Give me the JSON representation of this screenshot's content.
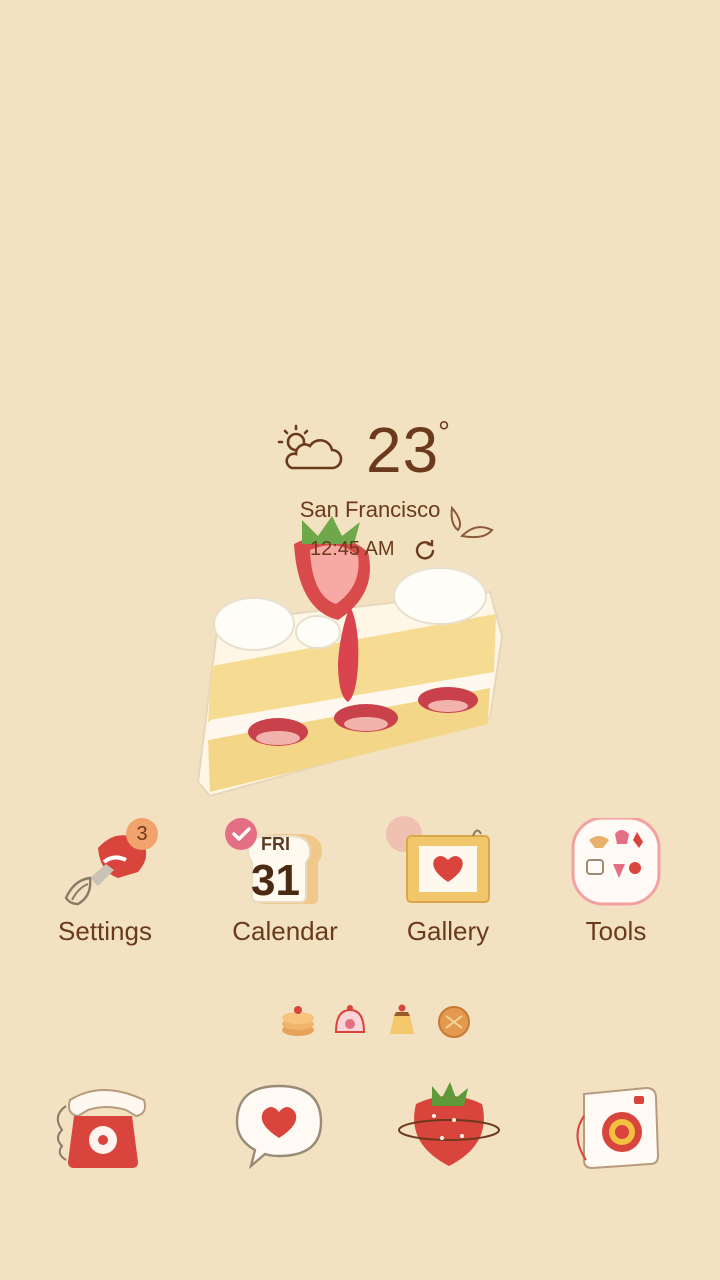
{
  "weather": {
    "temperature": "23",
    "degree_symbol": "°",
    "city": "San Francisco",
    "time": "12:45 AM",
    "condition_icon": "partly-cloudy-icon"
  },
  "apps": [
    {
      "label": "Settings",
      "icon": "mixer-icon",
      "badge": "3"
    },
    {
      "label": "Calendar",
      "icon": "bread-calendar-icon",
      "day": "FRI",
      "date": "31"
    },
    {
      "label": "Gallery",
      "icon": "picture-frame-heart-icon"
    },
    {
      "label": "Tools",
      "icon": "tools-folder-icon"
    }
  ],
  "dock": [
    {
      "icon": "phone-icon"
    },
    {
      "icon": "message-icon"
    },
    {
      "icon": "strawberry-store-icon"
    },
    {
      "icon": "camera-icon"
    }
  ],
  "page_indicator_icons": [
    "pancake-icon",
    "cake-roll-icon",
    "pudding-icon",
    "cookie-icon"
  ],
  "colors": {
    "background": "#f2e2c2",
    "text": "#6b3a1c",
    "accent_red": "#d9443c",
    "badge_orange": "#f2a36c",
    "check_pink": "#e46f84"
  }
}
